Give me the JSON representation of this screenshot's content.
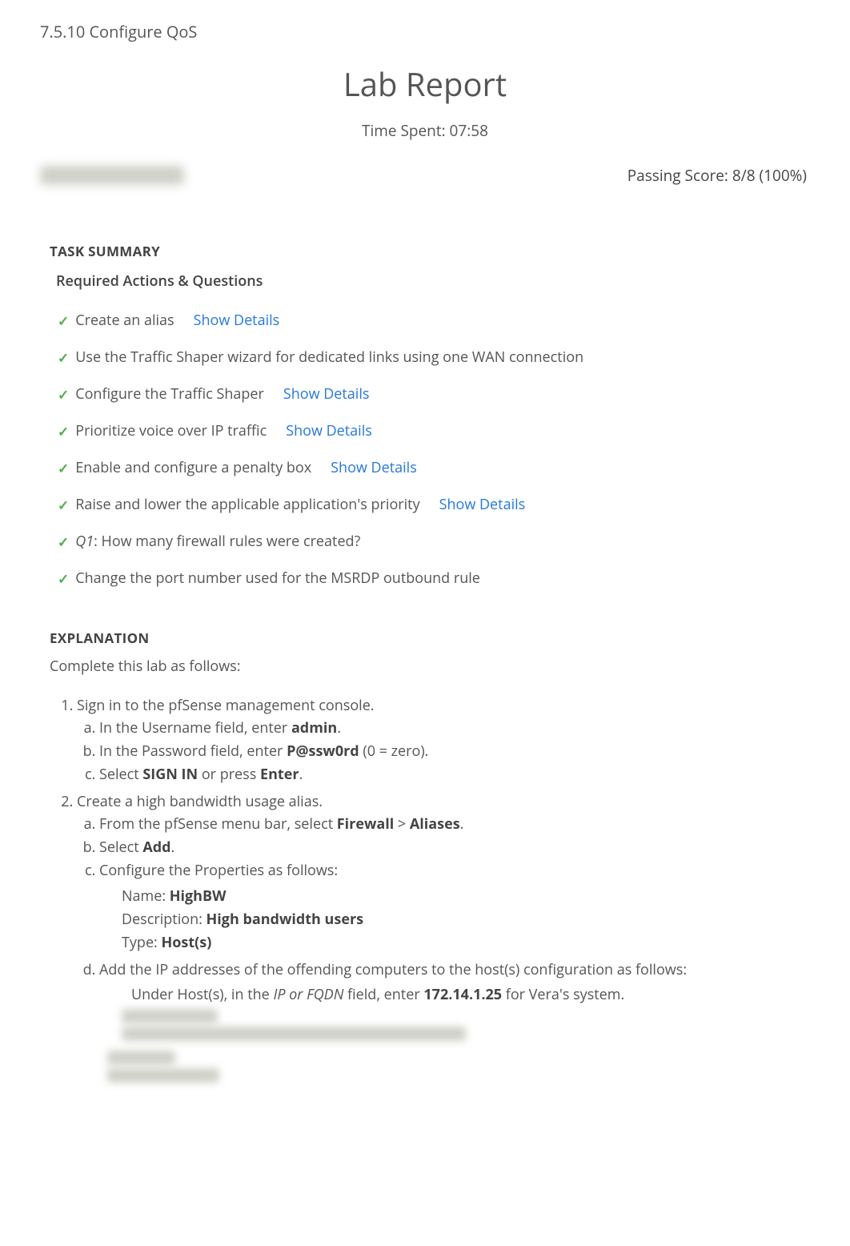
{
  "header": {
    "breadcrumb": "7.5.10 Configure QoS",
    "title": "Lab Report",
    "time_spent_label": "Time Spent: 07:58",
    "passing_score": "Passing Score: 8/8 (100%)"
  },
  "task_summary": {
    "heading": "TASK SUMMARY",
    "subheading": "Required Actions & Questions",
    "show_details_label": "Show Details",
    "items": [
      {
        "text": "Create an alias",
        "has_details": true
      },
      {
        "text": "Use the Traffic Shaper wizard for dedicated links using one WAN connection",
        "has_details": false
      },
      {
        "text": "Configure the Traffic Shaper",
        "has_details": true
      },
      {
        "text": "Prioritize voice over IP traffic",
        "has_details": true
      },
      {
        "text": "Enable and configure a penalty box",
        "has_details": true
      },
      {
        "text": "Raise and lower the applicable application's priority",
        "has_details": true
      },
      {
        "q_prefix": "Q1",
        "text": ":  How many firewall rules were created?",
        "has_details": false
      },
      {
        "text": "Change the port number used for the MSRDP outbound rule",
        "has_details": false
      }
    ]
  },
  "explanation": {
    "heading": "EXPLANATION",
    "intro": "Complete this lab as follows:",
    "step1": {
      "text": "Sign in to the pfSense management console.",
      "a_pre": "In the Username field, enter ",
      "a_bold": "admin",
      "a_post": ".",
      "b_pre": "In the Password field, enter ",
      "b_bold": "P@ssw0rd",
      "b_post": " (0 = zero).",
      "c_pre": "Select ",
      "c_bold1": "SIGN IN",
      "c_mid": " or press ",
      "c_bold2": "Enter",
      "c_post": "."
    },
    "step2": {
      "text": "Create a high bandwidth usage alias.",
      "a_pre": "From the pfSense menu bar, select ",
      "a_bold1": "Firewall",
      "a_mid": " > ",
      "a_bold2": "Aliases",
      "a_post": ".",
      "b_pre": "Select ",
      "b_bold": "Add",
      "b_post": ".",
      "c_text": "Configure the Properties as follows:",
      "props": {
        "name_label": "Name: ",
        "name_val": "HighBW",
        "desc_label": "Description: ",
        "desc_val": "High bandwidth users",
        "type_label": "Type: ",
        "type_val": "Host(s)"
      },
      "d_text": "Add the IP addresses of the offending computers to the host(s) configuration as follows:",
      "d_sub_pre": "Under Host(s), in the ",
      "d_sub_ital": "IP or FQDN",
      "d_sub_mid": " field, enter ",
      "d_sub_bold": "172.14.1.25",
      "d_sub_post": " for Vera's system."
    }
  }
}
